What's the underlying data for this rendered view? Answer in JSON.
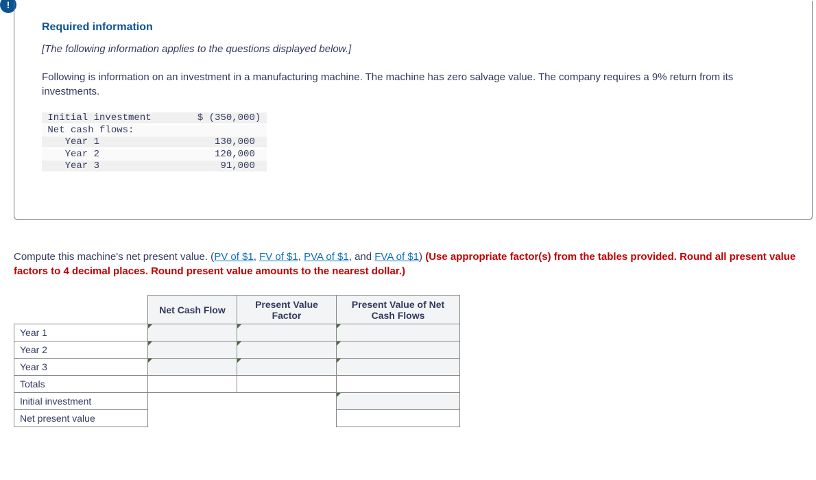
{
  "alert_glyph": "!",
  "heading": "Required information",
  "applies_note": "[The following information applies to the questions displayed below.]",
  "description": "Following is information on an investment in a manufacturing machine. The machine has zero salvage value. The company requires a 9% return from its investments.",
  "mono": {
    "rows": [
      {
        "label": " Initial investment        ",
        "value": "$ (350,000) "
      },
      {
        "label": " Net cash flows:           ",
        "value": "            "
      },
      {
        "label": "    Year 1                 ",
        "value": "   130,000  "
      },
      {
        "label": "    Year 2                 ",
        "value": "   120,000  "
      },
      {
        "label": "    Year 3                 ",
        "value": "    91,000  "
      }
    ]
  },
  "compute_prefix": "Compute this machine's net present value. (",
  "link_pv": "PV of $1",
  "sep1": ", ",
  "link_fv": "FV of $1",
  "sep2": ", ",
  "link_pva": "PVA of $1",
  "sep3": ", and ",
  "link_fva": "FVA of $1",
  "paren_close": ") ",
  "red_instr": "(Use appropriate factor(s) from the tables provided. Round all present value factors to 4 decimal places. Round present value amounts to the nearest dollar.)",
  "answer_table": {
    "headers": {
      "ncf": "Net Cash Flow",
      "pvf": "Present Value Factor",
      "pvnet": "Present Value of Net Cash Flows"
    },
    "rows": [
      {
        "label": "Year 1"
      },
      {
        "label": "Year 2"
      },
      {
        "label": "Year 3"
      },
      {
        "label": "Totals"
      },
      {
        "label": "Initial investment"
      },
      {
        "label": "Net present value"
      }
    ]
  }
}
